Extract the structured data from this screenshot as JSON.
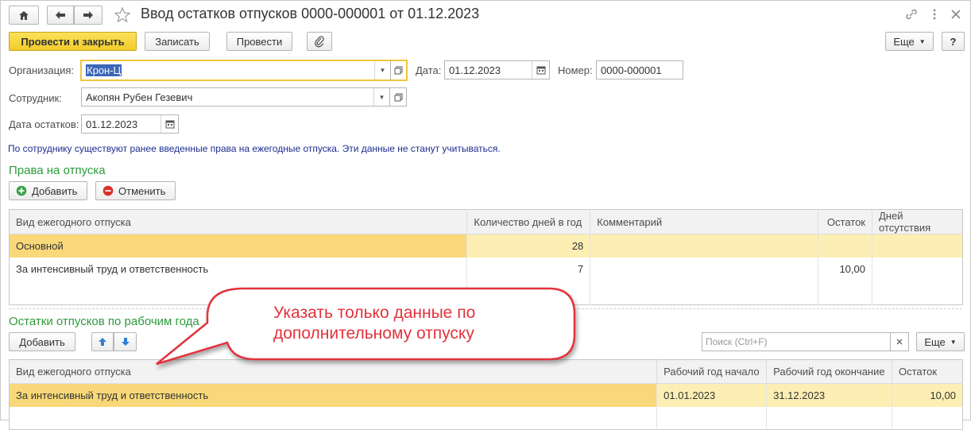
{
  "window": {
    "title": "Ввод остатков отпусков 0000-000001 от 01.12.2023"
  },
  "toolbar": {
    "post_close": "Провести и закрыть",
    "save": "Записать",
    "post": "Провести",
    "more": "Еще",
    "help": "?"
  },
  "header": {
    "org_label": "Организация:",
    "org_value": "Крон-Ц",
    "date_label": "Дата:",
    "date_value": "01.12.2023",
    "number_label": "Номер:",
    "number_value": "0000-000001",
    "employee_label": "Сотрудник:",
    "employee_value": "Акопян Рубен Гезевич",
    "balance_date_label": "Дата остатков:",
    "balance_date_value": "01.12.2023"
  },
  "info_message": "По сотруднику существуют ранее введенные права на ежегодные отпуска. Эти данные не станут учитываться.",
  "rights": {
    "title": "Права на отпуска",
    "add": "Добавить",
    "cancel": "Отменить",
    "columns": [
      "Вид ежегодного отпуска",
      "Количество дней в год",
      "Комментарий",
      "Остаток",
      "Дней отсутствия"
    ],
    "rows": [
      {
        "type": "Основной",
        "days": "28",
        "comment": "",
        "balance": "",
        "absent": ""
      },
      {
        "type": "За интенсивный труд и ответственность",
        "days": "7",
        "comment": "",
        "balance": "10,00",
        "absent": ""
      }
    ]
  },
  "balances": {
    "title": "Остатки отпусков по рабочим года",
    "add": "Добавить",
    "search_placeholder": "Поиск (Ctrl+F)",
    "more": "Еще",
    "columns": [
      "Вид ежегодного отпуска",
      "Рабочий год начало",
      "Рабочий год окончание",
      "Остаток"
    ],
    "rows": [
      {
        "type": "За интенсивный труд и ответственность",
        "start": "01.01.2023",
        "end": "31.12.2023",
        "balance": "10,00"
      }
    ]
  },
  "callout": {
    "line1": "Указать только данные по",
    "line2": "дополнительному отпуску",
    "color": "#e2333c"
  },
  "colors": {
    "primary_button": "#f4d03f",
    "section_title": "#2d9a3c",
    "info_text": "#1c2d8e",
    "selected_row": "#fdefb4"
  }
}
